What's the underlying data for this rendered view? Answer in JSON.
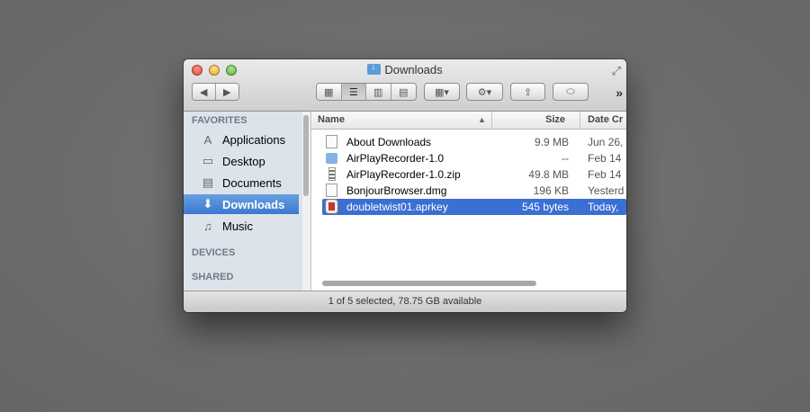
{
  "window": {
    "title": "Downloads",
    "status_text": "1 of 5 selected, 78.75 GB available"
  },
  "toolbar": {
    "back_icon": "◀",
    "forward_icon": "▶",
    "view_icons": [
      "▦",
      "☰",
      "▥",
      "▤"
    ],
    "arrange_icon": "▦▾",
    "action_icon": "⚙▾",
    "share_icon": "⇪",
    "toggle_icon": "⬭",
    "overflow": "»"
  },
  "sidebar": {
    "favorites_header": "FAVORITES",
    "items": [
      {
        "label": "Applications",
        "icon": "applications-icon",
        "glyph": "A",
        "active": false
      },
      {
        "label": "Desktop",
        "icon": "desktop-icon",
        "glyph": "▭",
        "active": false
      },
      {
        "label": "Documents",
        "icon": "documents-icon",
        "glyph": "▤",
        "active": false
      },
      {
        "label": "Downloads",
        "icon": "downloads-icon",
        "glyph": "⬇",
        "active": true
      },
      {
        "label": "Music",
        "icon": "music-icon",
        "glyph": "♫",
        "active": false
      }
    ],
    "devices_header": "DEVICES",
    "shared_header": "SHARED"
  },
  "list": {
    "columns": {
      "name": "Name",
      "size": "Size",
      "date": "Date Cr",
      "sort_indicator": "▲"
    },
    "rows": [
      {
        "name": "About Downloads",
        "size": "9.9 MB",
        "date": "Jun 26,",
        "icon": "document-icon",
        "selected": false
      },
      {
        "name": "AirPlayRecorder-1.0",
        "size": "--",
        "date": "Feb 14",
        "icon": "folder-icon",
        "selected": false
      },
      {
        "name": "AirPlayRecorder-1.0.zip",
        "size": "49.8 MB",
        "date": "Feb 14",
        "icon": "zip-icon",
        "selected": false
      },
      {
        "name": "BonjourBrowser.dmg",
        "size": "196 KB",
        "date": "Yesterd",
        "icon": "dmg-icon",
        "selected": false
      },
      {
        "name": "doubletwist01.aprkey",
        "size": "545 bytes",
        "date": "Today,",
        "icon": "key-file-icon",
        "selected": true
      }
    ]
  },
  "colors": {
    "selection": "#3b6fd4",
    "sidebar_bg": "#dde3ea"
  }
}
